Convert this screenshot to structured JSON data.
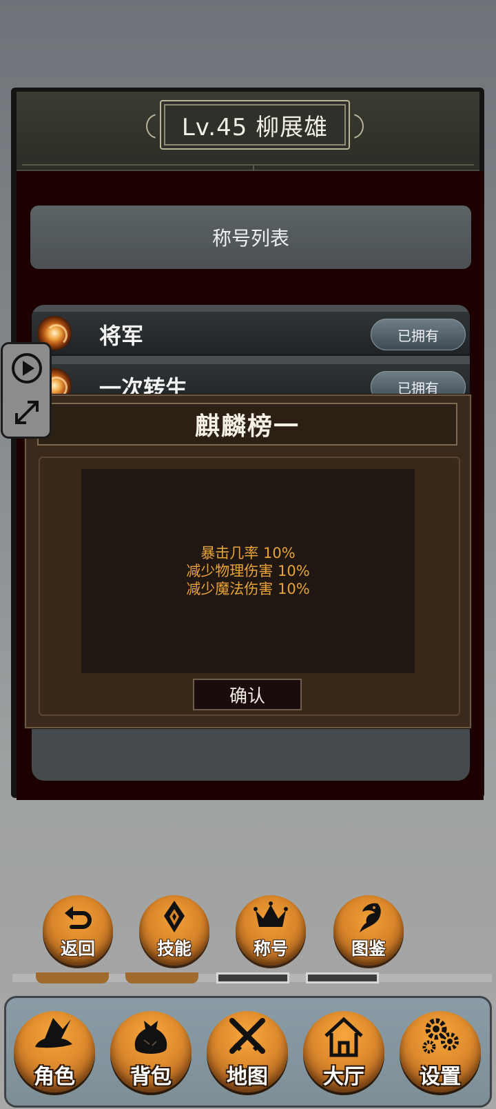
{
  "character": {
    "level_name": "Lv.45 柳展雄"
  },
  "titles_panel": {
    "header": "称号列表",
    "rows": [
      {
        "name": "将军",
        "status": "已拥有"
      },
      {
        "name": "一次转生",
        "status": "已拥有"
      }
    ]
  },
  "modal": {
    "title": "麒麟榜一",
    "attributes": [
      "暴击几率 10%",
      "减少物理伤害 10%",
      "减少魔法伤害 10%"
    ],
    "confirm_label": "确认"
  },
  "sub_menu": [
    {
      "label": "返回",
      "icon": "return-icon"
    },
    {
      "label": "技能",
      "icon": "skill-icon"
    },
    {
      "label": "称号",
      "icon": "crown-icon"
    },
    {
      "label": "图鉴",
      "icon": "dragon-icon"
    }
  ],
  "bottom_nav": [
    {
      "label": "角色",
      "icon": "wizard-hat-icon"
    },
    {
      "label": "背包",
      "icon": "bag-icon"
    },
    {
      "label": "地图",
      "icon": "crossed-swords-icon"
    },
    {
      "label": "大厅",
      "icon": "house-icon"
    },
    {
      "label": "设置",
      "icon": "gears-icon"
    }
  ],
  "colors": {
    "panel_body": "#1d0000",
    "modal_bg": "#3b2a1c",
    "attribute_text": "#e8a436",
    "button_orange": "#dd8a2d"
  }
}
